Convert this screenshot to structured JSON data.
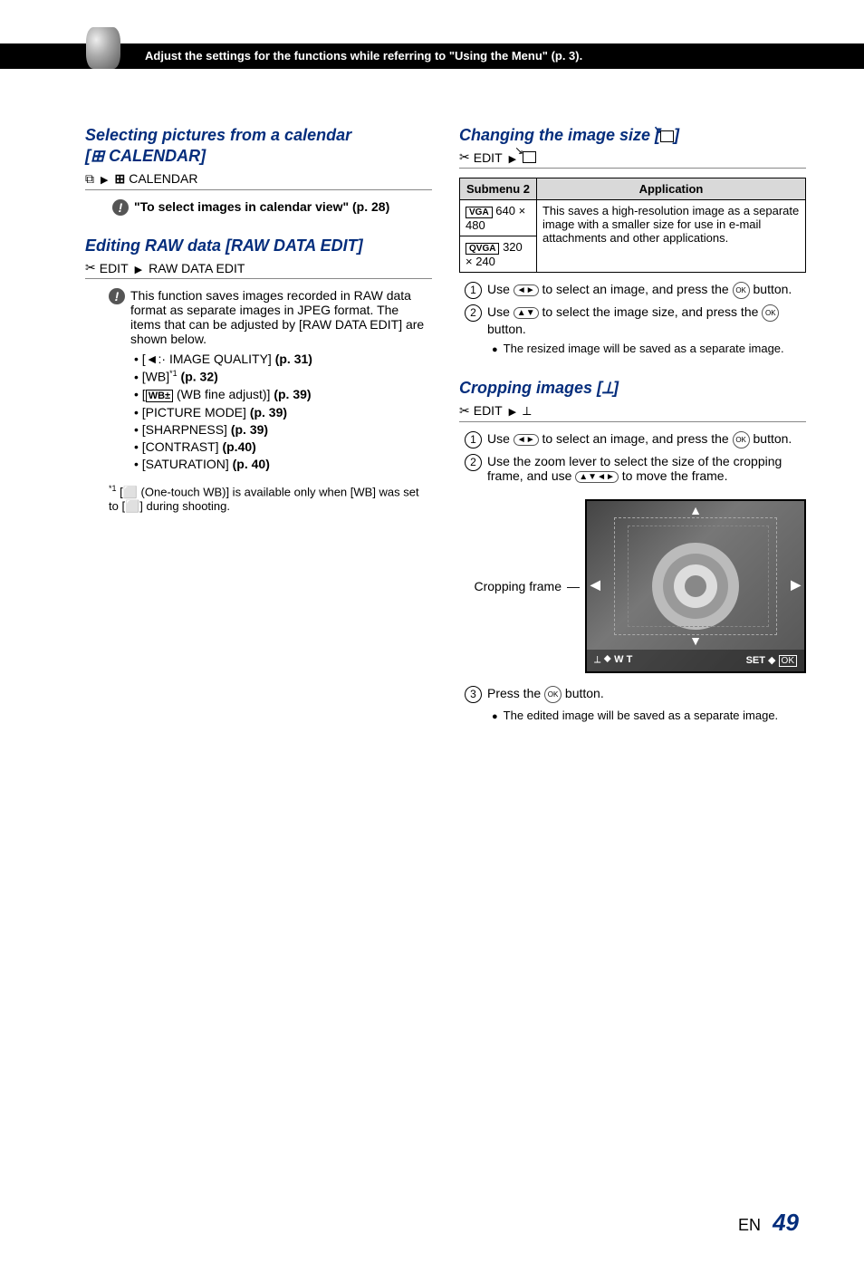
{
  "header": {
    "text": "Adjust the settings for the functions while referring to \"Using the Menu\" (p. 3)."
  },
  "left": {
    "sec1": {
      "title": "Selecting pictures from a calendar [  CALENDAR]",
      "path": "CALENDAR",
      "tip": "\"To select images in calendar view\" (p. 28)"
    },
    "sec2": {
      "title": "Editing RAW data [RAW DATA EDIT]",
      "path_left": "EDIT",
      "path_right": "RAW DATA EDIT",
      "body": "This function saves images recorded in RAW data format as separate images in JPEG format. The items that can be adjusted by [RAW DATA EDIT] are shown below.",
      "bullets": [
        "[    IMAGE QUALITY] (p. 31)",
        "[WB]*1 (p. 32)",
        "[ WB± (WB fine adjust)] (p. 39)",
        "[PICTURE MODE] (p. 39)",
        "[SHARPNESS] (p. 39)",
        "[CONTRAST] (p.40)",
        "[SATURATION] (p. 40)"
      ],
      "footnote": "*1 [   (One-touch WB)] is available only when [WB] was set to [  ] during shooting."
    }
  },
  "right": {
    "sec1": {
      "title": "Changing the image size [  ]",
      "path_left": "EDIT",
      "table": {
        "h1": "Submenu 2",
        "h2": "Application",
        "r1c1": "640 × 480",
        "r2c1": "320 × 240",
        "app": "This saves a high-resolution image as a separate image with a smaller size for use in e-mail attachments and other applications."
      },
      "step1": "Use    to select an image, and press the    button.",
      "step2": "Use    to select the image size, and press the    button.",
      "note": "The resized image will be saved as a separate image."
    },
    "sec2": {
      "title": "Cropping images [  ]",
      "path_left": "EDIT",
      "step1": "Use    to select an image, and press the    button.",
      "step2": "Use the zoom lever to select the size of the cropping frame, and use      to move the frame.",
      "label": "Cropping frame",
      "bar_left": "W T",
      "bar_right_set": "SET",
      "bar_right_ok": "OK",
      "step3": "Press the    button.",
      "note": "The edited image will be saved as a separate image."
    }
  },
  "footer": {
    "lang": "EN",
    "page": "49"
  }
}
